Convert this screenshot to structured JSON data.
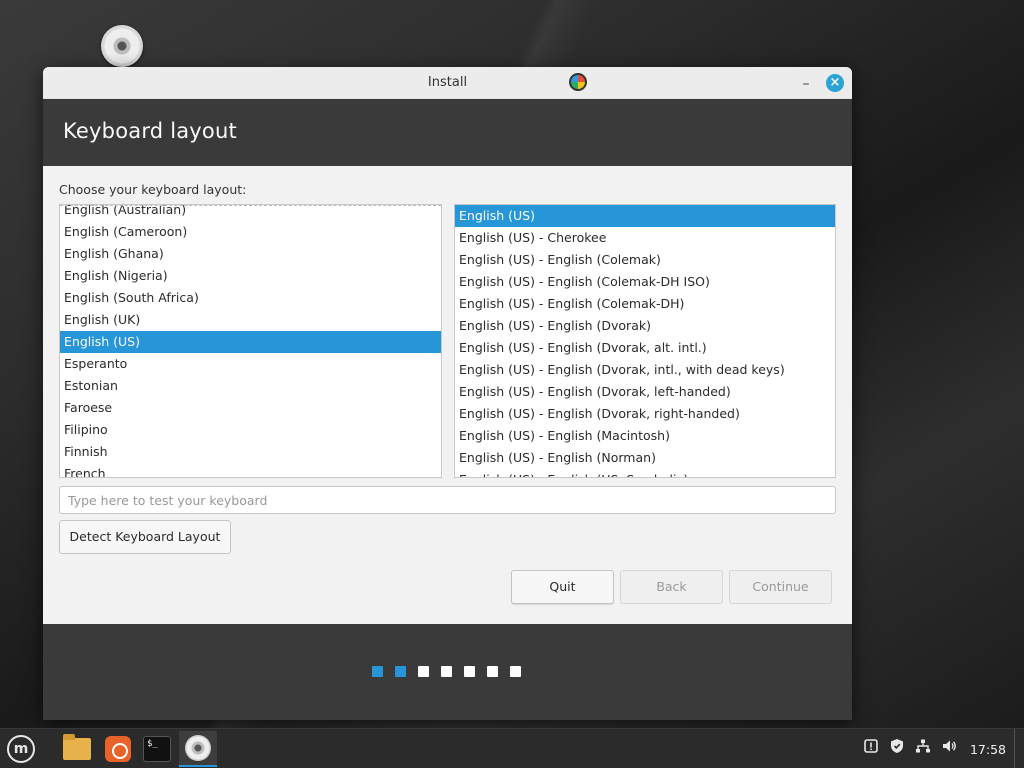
{
  "window": {
    "title": "Install",
    "minimize_glyph": "–",
    "close_glyph": "×"
  },
  "header": {
    "title": "Keyboard layout"
  },
  "prompt": "Choose your keyboard layout:",
  "layouts": {
    "items": [
      "English (Australian)",
      "English (Cameroon)",
      "English (Ghana)",
      "English (Nigeria)",
      "English (South Africa)",
      "English (UK)",
      "English (US)",
      "Esperanto",
      "Estonian",
      "Faroese",
      "Filipino",
      "Finnish",
      "French"
    ],
    "selected": "English (US)"
  },
  "variants": {
    "items": [
      "English (US)",
      "English (US) - Cherokee",
      "English (US) - English (Colemak)",
      "English (US) - English (Colemak-DH ISO)",
      "English (US) - English (Colemak-DH)",
      "English (US) - English (Dvorak)",
      "English (US) - English (Dvorak, alt. intl.)",
      "English (US) - English (Dvorak, intl., with dead keys)",
      "English (US) - English (Dvorak, left-handed)",
      "English (US) - English (Dvorak, right-handed)",
      "English (US) - English (Macintosh)",
      "English (US) - English (Norman)",
      "English (US) - English (US, Symbolic)"
    ],
    "selected": "English (US)"
  },
  "test_input": {
    "placeholder": "Type here to test your keyboard",
    "value": ""
  },
  "buttons": {
    "detect": "Detect Keyboard Layout",
    "quit": "Quit",
    "back": "Back",
    "continue": "Continue"
  },
  "progress": {
    "total_steps": 7,
    "completed_steps": 2
  },
  "taskbar": {
    "clock": "17:58",
    "terminal_glyph": "$_",
    "mint_glyph": "m",
    "tray_icons": [
      "update-manager-icon",
      "shield-icon",
      "network-icon",
      "volume-icon"
    ]
  },
  "colors": {
    "accent": "#2796d8",
    "header": "#3a3a3a",
    "window_bg": "#f2f2f2"
  }
}
